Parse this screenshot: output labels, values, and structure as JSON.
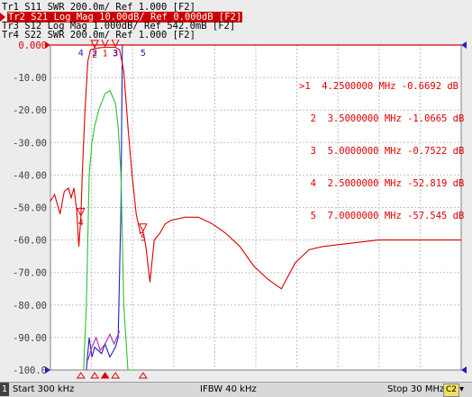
{
  "traces": [
    {
      "label": "Tr1 S11 SWR 200.0m/ Ref 1.000 [F2]",
      "color": "#2020c0",
      "active": false
    },
    {
      "label": "Tr2 S21 Log Mag 10.00dB/ Ref 0.000dB [F2]",
      "color": "#cc0000",
      "active": true
    },
    {
      "label": "Tr3 S12 Log Mag 1.000dB/ Ref 542.0mB [F2]",
      "color": "#2fbf2f",
      "active": false
    },
    {
      "label": "Tr4 S22 SWR 200.0m/ Ref 1.000 [F2]",
      "color": "#b020b0",
      "active": false
    }
  ],
  "y_axis": {
    "labels": [
      "0.000",
      "-10.00",
      "-20.00",
      "-30.00",
      "-40.00",
      "-50.00",
      "-60.00",
      "-70.00",
      "-80.00",
      "-90.00",
      "-100.0"
    ]
  },
  "markers": {
    "rows": [
      ">1  4.2500000 MHz -0.6692 dB",
      "  2  3.5000000 MHz -1.0665 dB",
      "  3  5.0000000 MHz -0.7522 dB",
      "  4  2.5000000 MHz -52.819 dB",
      "  5  7.0000000 MHz -57.545 dB"
    ]
  },
  "status": {
    "channel": "1",
    "start": "Start 300 kHz",
    "ifbw": "IFBW 40 kHz",
    "stop": "Stop 30 MHz",
    "correction": "C2",
    "menu": "▾"
  },
  "colors": {
    "background": "#ffffff",
    "grid": "#c0c0c0",
    "s21": "#dd0000",
    "s12": "#2fbf2f",
    "s11": "#2020c0",
    "s22": "#b020b0",
    "axis_text": "#404040"
  },
  "chart_data": {
    "type": "line",
    "x_unit": "MHz",
    "x_range": [
      0.3,
      30
    ],
    "y_range": [
      -100,
      0
    ],
    "series": [
      {
        "name": "Tr2 S21",
        "x": [
          0.3,
          0.6,
          1.0,
          1.3,
          1.6,
          1.8,
          2.0,
          2.2,
          2.35,
          2.5,
          2.6,
          2.8,
          3.0,
          3.2,
          3.5,
          3.8,
          4.25,
          4.7,
          5.0,
          5.3,
          5.6,
          5.9,
          6.2,
          6.5,
          6.8,
          7.0,
          7.2,
          7.5,
          7.8,
          8.2,
          8.6,
          9.0,
          10.0,
          11.0,
          12.0,
          13.0,
          14.0,
          15.0,
          16.0,
          17.0,
          18.0,
          19.0,
          20.0,
          22.0,
          24.0,
          26.0,
          28.0,
          30.0
        ],
        "values": [
          -48,
          -46,
          -52,
          -45,
          -44,
          -47,
          -44,
          -51,
          -62,
          -52.8,
          -40,
          -20,
          -5,
          -1.5,
          -1.07,
          -0.9,
          -0.67,
          -0.7,
          -0.75,
          -1.5,
          -8,
          -25,
          -40,
          -52,
          -58,
          -57.5,
          -62,
          -73,
          -60,
          -58,
          -55,
          -54,
          -53,
          -53,
          -55,
          -58,
          -62,
          -68,
          -72,
          -75,
          -67,
          -63,
          -62,
          -61,
          -60,
          -60,
          -60,
          -60
        ]
      },
      {
        "name": "Tr3 S12",
        "x": [
          2.7,
          2.9,
          3.1,
          3.3,
          3.5,
          3.8,
          4.25,
          4.6,
          5.0,
          5.2,
          5.4,
          5.6,
          5.9,
          6.5
        ],
        "values": [
          -100,
          -80,
          -40,
          -30,
          -25,
          -20,
          -15,
          -14,
          -18,
          -25,
          -40,
          -80,
          -100,
          -100
        ]
      },
      {
        "name": "Tr1 S11",
        "x": [
          2.9,
          3.1,
          3.3,
          3.5,
          4.0,
          4.25,
          4.6,
          5.0,
          5.2,
          5.4,
          5.5
        ],
        "values": [
          -100,
          -90,
          -96,
          -93,
          -95,
          -92,
          -96,
          -93,
          -90,
          -50,
          0
        ]
      },
      {
        "name": "Tr4 S22",
        "x": [
          3.0,
          3.3,
          3.6,
          3.9,
          4.25,
          4.6,
          4.9,
          5.1,
          5.3
        ],
        "values": [
          -97,
          -93,
          -90,
          -94,
          -92,
          -89,
          -92,
          -90,
          -88
        ]
      }
    ],
    "markers": [
      {
        "id": "1",
        "x": 4.25,
        "y": -0.6692
      },
      {
        "id": "2",
        "x": 3.5,
        "y": -1.0665
      },
      {
        "id": "3",
        "x": 5.0,
        "y": -0.7522
      },
      {
        "id": "4",
        "x": 2.5,
        "y": -52.819
      },
      {
        "id": "5",
        "x": 7.0,
        "y": -57.545
      }
    ]
  }
}
